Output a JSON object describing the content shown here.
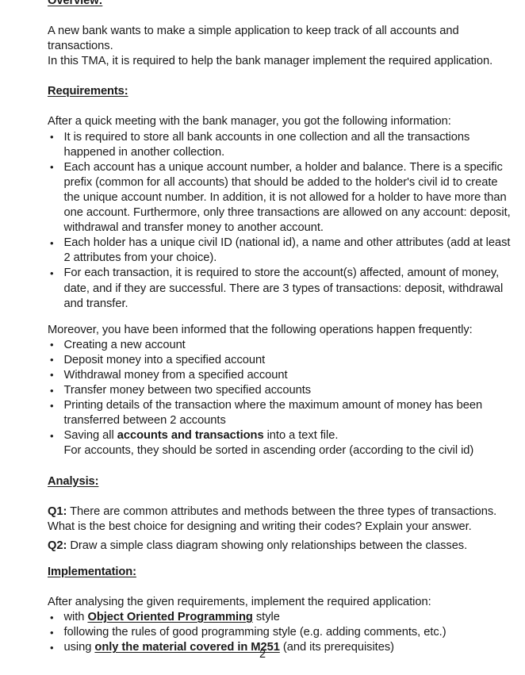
{
  "document": {
    "page_number": "2",
    "sections": {
      "overview": {
        "heading": "Overview:",
        "paragraph_line1": "A new bank wants to make a simple application to keep track of all accounts and transactions.",
        "paragraph_line2": "In this TMA, it is required to help the bank manager implement the required application."
      },
      "requirements": {
        "heading": "Requirements:",
        "intro": "After a quick meeting with the bank manager, you got the following information:",
        "bullets": [
          "It is required to store all bank accounts in one collection and all the transactions happened in another collection.",
          "Each account has a unique account number, a holder and balance. There is a specific prefix (common for all accounts) that should be added to the holder's civil id to create the unique account number. In addition, it is not allowed for a holder to have more than one account. Furthermore, only three transactions are allowed on any account: deposit, withdrawal and transfer money to another account.",
          "Each holder has a unique civil ID (national id), a name and other attributes (add at least 2 attributes from your choice).",
          "For each transaction, it is required to store the account(s) affected, amount of money, date, and if they are successful. There are 3 types of transactions: deposit, withdrawal and transfer."
        ],
        "operations_intro": "Moreover, you have been informed that the following operations happen frequently:",
        "operations": [
          "Creating a new account",
          "Deposit money into a specified account",
          "Withdrawal money from a specified account",
          "Transfer money between two specified accounts",
          "Printing details of the transaction where the maximum amount of money has been transferred between 2 accounts"
        ],
        "saving_bullet": {
          "prefix": "Saving all ",
          "emphasis": "accounts and transactions",
          "suffix": " into a text file.",
          "second_line": "For accounts, they should be sorted in ascending order (according to the civil id)"
        }
      },
      "analysis": {
        "heading": "Analysis:",
        "q1": {
          "label": "Q1:",
          "text": " There are common attributes and methods between the three types of transactions. What is the best choice for designing and writing their codes? Explain your answer."
        },
        "q2": {
          "label": "Q2:",
          "text": " Draw a simple class diagram showing only relationships between the classes."
        }
      },
      "implementation": {
        "heading": "Implementation:",
        "intro": "After analysing the given requirements, implement the required application:",
        "bullets": [
          {
            "prefix": "with ",
            "emphasis": "Object Oriented Programming",
            "suffix": " style"
          },
          {
            "prefix": "following the rules of good programming style (e.g. adding comments, etc.)",
            "emphasis": "",
            "suffix": ""
          },
          {
            "prefix": "using ",
            "emphasis": "only the material covered in M251",
            "suffix": " (and its prerequisites)"
          }
        ]
      }
    }
  }
}
